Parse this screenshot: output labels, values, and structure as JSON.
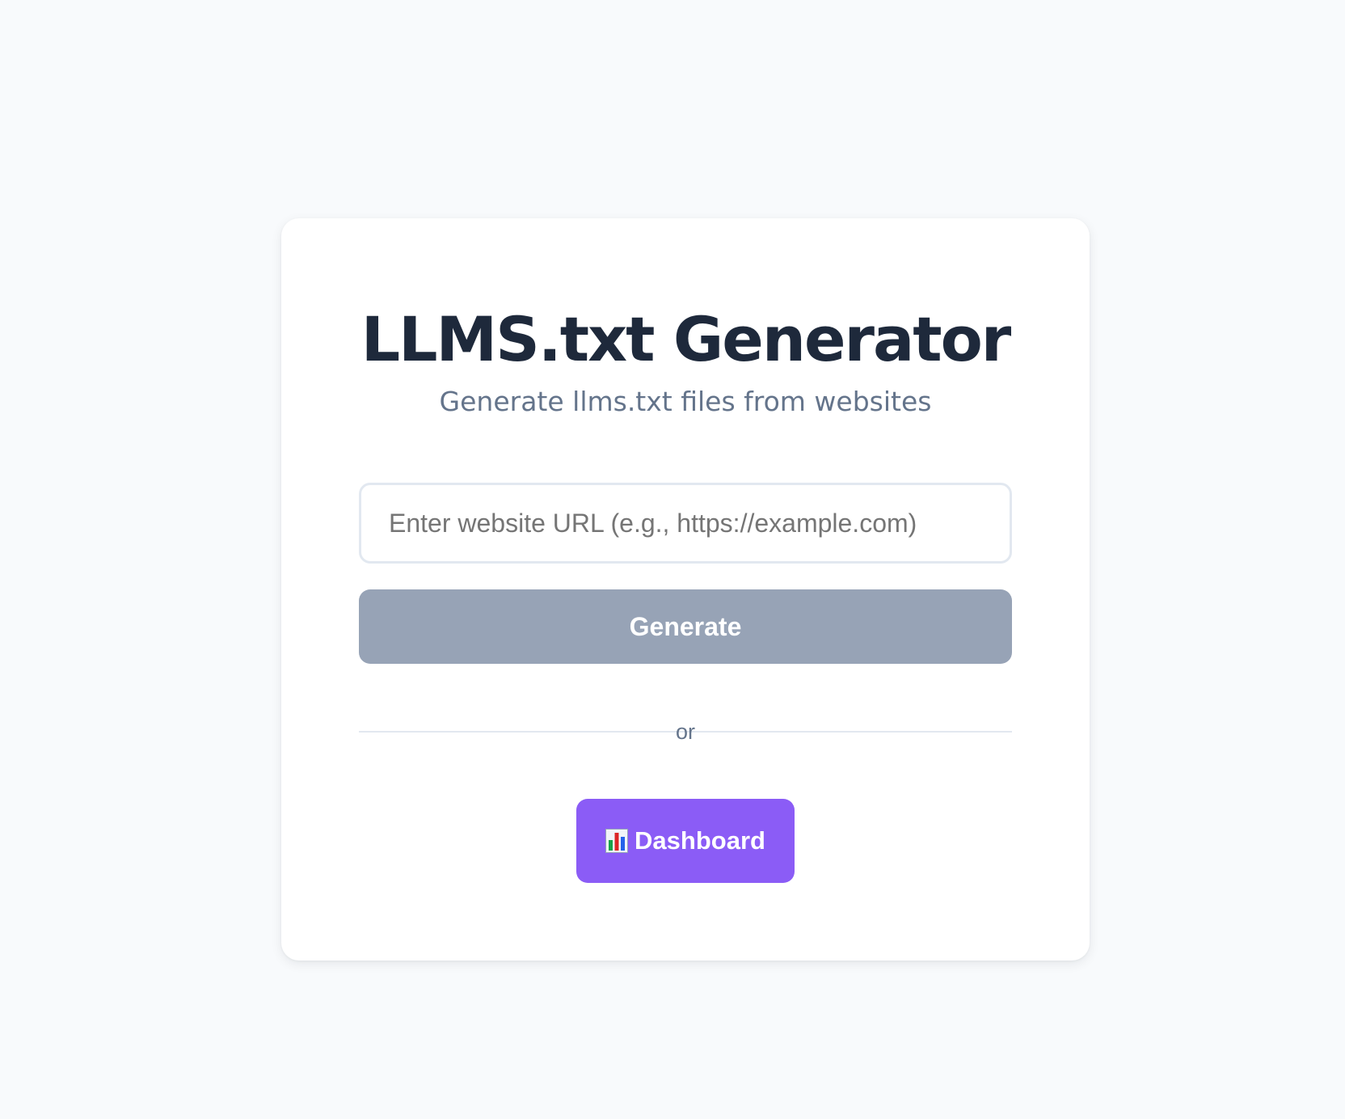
{
  "header": {
    "title": "LLMS.txt Generator",
    "subtitle": "Generate llms.txt files from websites"
  },
  "form": {
    "url_placeholder": "Enter website URL (e.g., https://example.com)",
    "url_value": "",
    "generate_label": "Generate",
    "generate_disabled": true
  },
  "divider": {
    "text": "or"
  },
  "dashboard": {
    "icon": "bar-chart-icon",
    "label": "Dashboard"
  },
  "colors": {
    "background": "#f8fafc",
    "card": "#ffffff",
    "title": "#1e293b",
    "subtitle": "#64748b",
    "generate_disabled": "#97a3b6",
    "dashboard_accent": "#8b5cf6"
  }
}
